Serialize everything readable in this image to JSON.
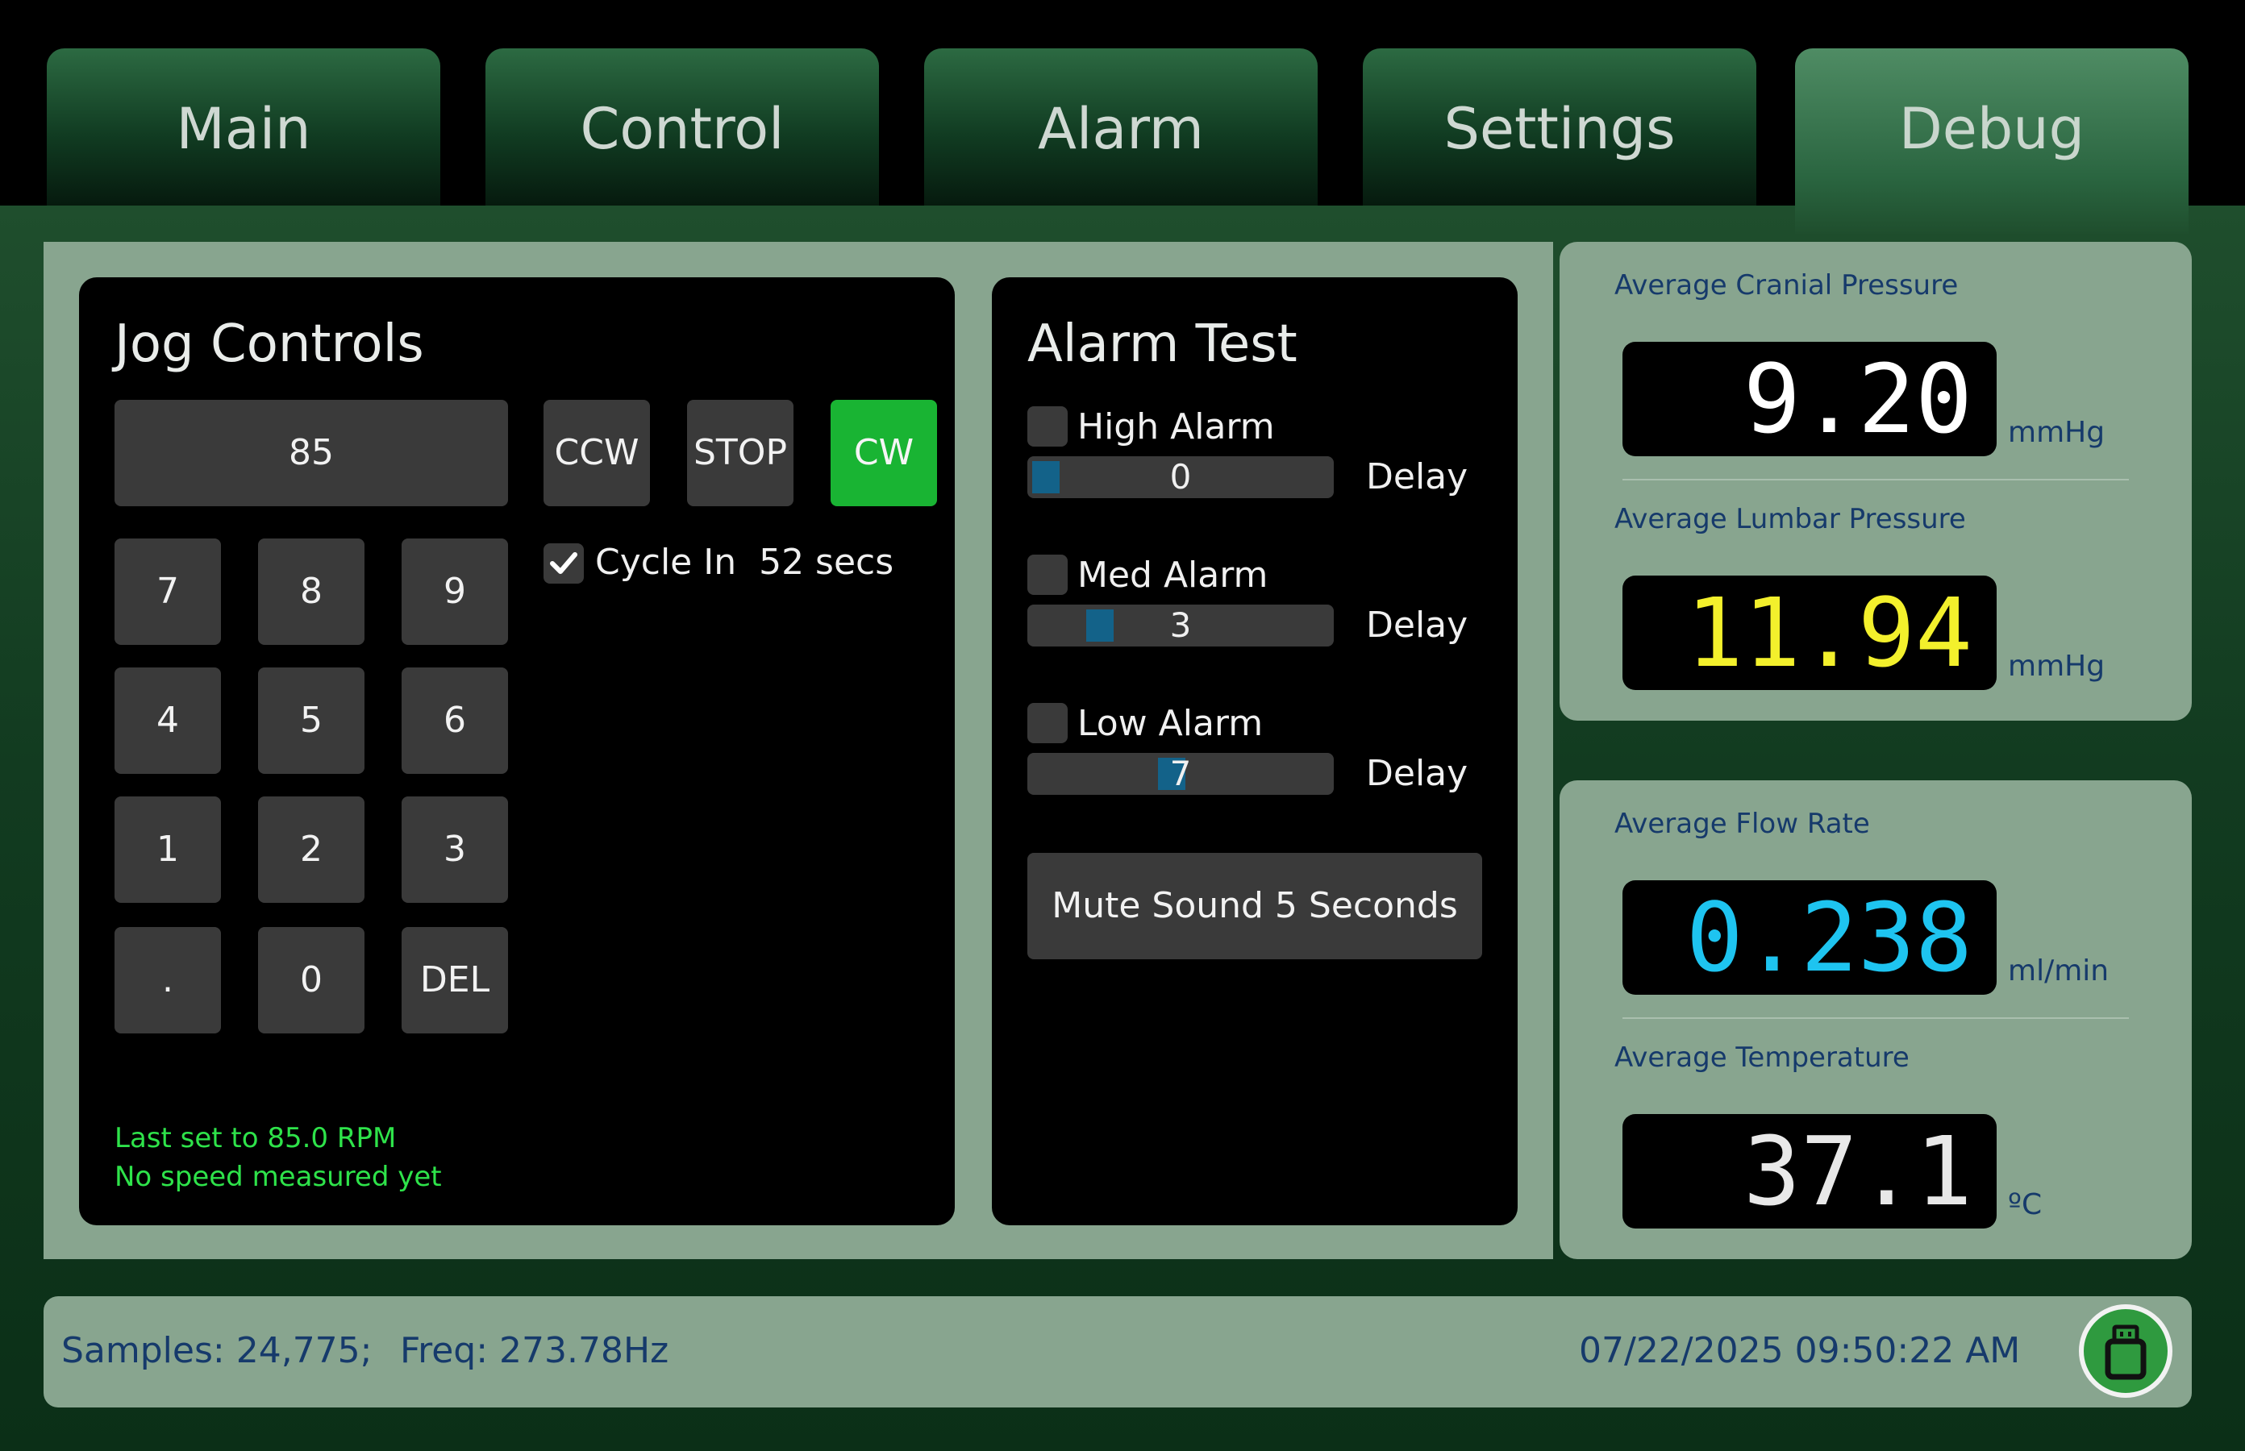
{
  "tabs": [
    "Main",
    "Control",
    "Alarm",
    "Settings",
    "Debug"
  ],
  "active_tab": "Debug",
  "jog": {
    "title": "Jog Controls",
    "speed_display": "85",
    "buttons": {
      "ccw": "CCW",
      "stop": "STOP",
      "cw": "CW"
    },
    "keypad": [
      "7",
      "8",
      "9",
      "4",
      "5",
      "6",
      "1",
      "2",
      "3",
      ".",
      "0",
      "DEL"
    ],
    "cycle_checked": true,
    "cycle_label": "Cycle In  52 secs",
    "status_line1": "Last set to 85.0 RPM",
    "status_line2": "No speed measured yet"
  },
  "alarm_test": {
    "title": "Alarm Test",
    "items": [
      {
        "label": "High Alarm",
        "value": "0",
        "delay_label": "Delay",
        "checked": false
      },
      {
        "label": "Med Alarm",
        "value": "3",
        "delay_label": "Delay",
        "checked": false
      },
      {
        "label": "Low Alarm",
        "value": "7",
        "delay_label": "Delay",
        "checked": false
      }
    ],
    "slider_max": 15,
    "mute_button": "Mute Sound 5 Seconds"
  },
  "readouts": {
    "cranial": {
      "label": "Average Cranial Pressure",
      "value": "9.20",
      "unit": "mmHg",
      "color": "#ffffff"
    },
    "lumbar": {
      "label": "Average Lumbar Pressure",
      "value": "11.94",
      "unit": "mmHg",
      "color": "#f3f02c"
    },
    "flow": {
      "label": "Average Flow Rate",
      "value": "0.238",
      "unit": "ml/min",
      "color": "#1ec4f0"
    },
    "temp": {
      "label": "Average Temperature",
      "value": "37.1",
      "unit": "ºC",
      "color": "#e8e8e8"
    }
  },
  "footer": {
    "samples": "Samples: 24,775;",
    "freq": "Freq: 273.78Hz",
    "datetime": "07/22/2025 09:50:22 AM",
    "usb_icon": "usb-drive-icon"
  },
  "colors": {
    "accent_green": "#19b433",
    "panel_gray": "#88a58f",
    "label_blue": "#163a6b",
    "status_green": "#2ee34a",
    "slider_handle": "#136289"
  }
}
